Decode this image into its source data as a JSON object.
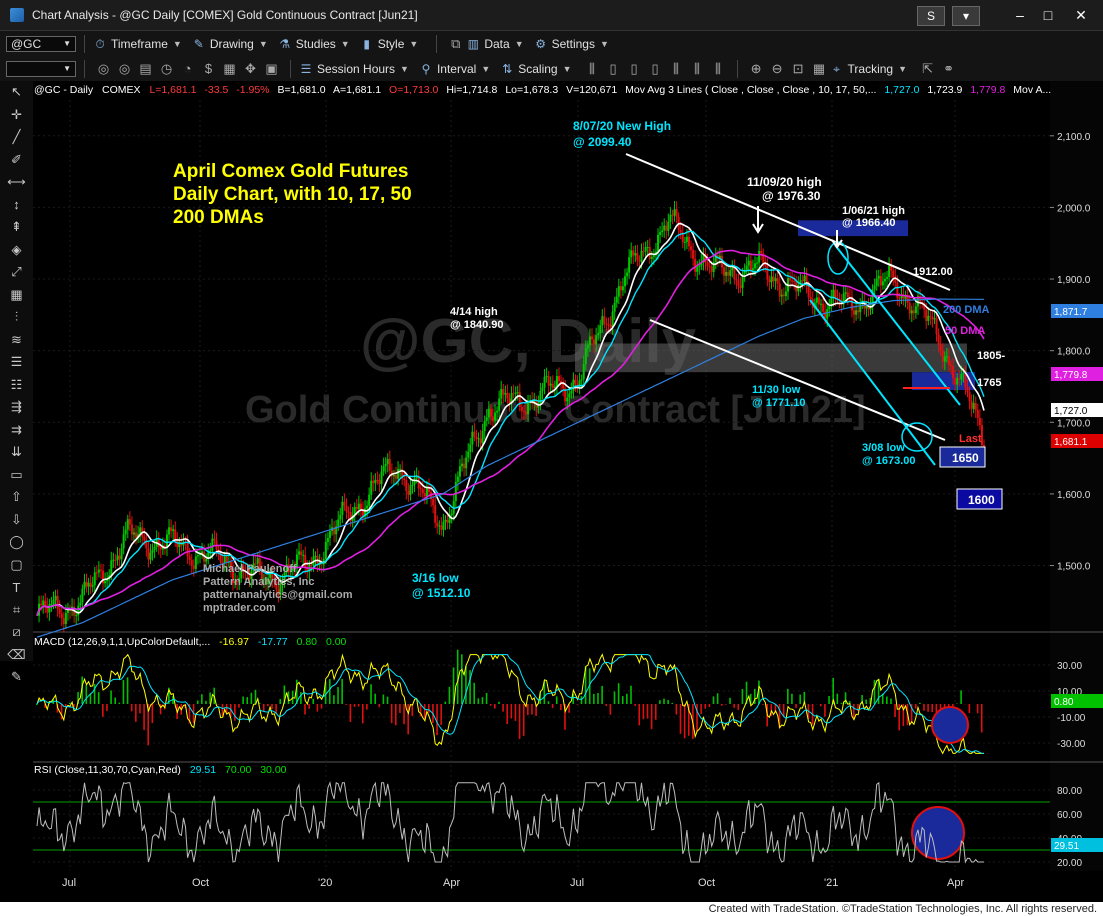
{
  "window": {
    "title": "Chart Analysis - @GC Daily [COMEX] Gold Continuous Contract [Jun21]",
    "s_button": "S",
    "minimize": "–",
    "maximize": "□",
    "close": "✕"
  },
  "toolbar1": {
    "symbol": "@GC",
    "timeframe": "Timeframe",
    "drawing": "Drawing",
    "studies": "Studies",
    "style": "Style",
    "data": "Data",
    "settings": "Settings"
  },
  "toolbar2": {
    "session_hours": "Session Hours",
    "interval": "Interval",
    "scaling": "Scaling",
    "tracking": "Tracking"
  },
  "status_line": {
    "symbol": "@GC - Daily",
    "exchange": "COMEX",
    "last": "L=1,681.1",
    "change": "-33.5",
    "change_pct": "-1.95%",
    "bid": "B=1,681.0",
    "ask": "A=1,681.1",
    "open": "O=1,713.0",
    "high": "Hi=1,714.8",
    "low": "Lo=1,678.3",
    "volume": "V=120,671",
    "study": "Mov Avg 3 Lines ( Close , Close , Close , 10, 17, 50,...",
    "ma1": "1,727.0",
    "ma2": "1,723.9",
    "ma3": "1,779.8",
    "tail": "Mov A..."
  },
  "colors": {
    "up_candle": "#00c800",
    "down_candle": "#e01010",
    "ma10": "#ffffff",
    "ma17": "#00e5ff",
    "ma50": "#e020e0",
    "ma200": "#2f7fe0",
    "annotation_yellow": "#ffff00",
    "annotation_cyan": "#00e5ff"
  },
  "chart_data": [
    {
      "type": "line",
      "title": "April Comex Gold Futures Daily Chart, with 10, 17, 50 200 DMAs",
      "watermark_symbol": "@GC, Daily",
      "watermark_name": "Gold Continuous Contract [Jun21]",
      "x_ticks": [
        "Jul",
        "Oct",
        "'20",
        "Apr",
        "Jul",
        "Oct",
        "'21",
        "Apr"
      ],
      "y_ticks": [
        "2,100.0",
        "2,000.0",
        "1,900.0",
        "1,800.0",
        "1,700.0",
        "1,600.0",
        "1,500.0"
      ],
      "ylim": [
        1410,
        2150
      ],
      "series": [
        {
          "name": "Price",
          "x": [
            "Jun'19",
            "Jul'19",
            "Aug'19",
            "Sep'19",
            "Oct'19",
            "Nov'19",
            "Dec'19",
            "Jan'20",
            "Feb'20",
            "Mar'20",
            "Apr'20",
            "May'20",
            "Jun'20",
            "Jul'20",
            "Aug'20",
            "Sep'20",
            "Oct'20",
            "Nov'20",
            "Dec'20",
            "Jan'21",
            "Feb'21",
            "Mar'21"
          ],
          "values": [
            1430,
            1450,
            1540,
            1530,
            1510,
            1480,
            1500,
            1580,
            1640,
            1560,
            1720,
            1735,
            1760,
            1900,
            1980,
            1910,
            1915,
            1880,
            1860,
            1900,
            1820,
            1680
          ]
        },
        {
          "name": "200 DMA",
          "values": [
            1400,
            1420,
            1450,
            1480,
            1500,
            1520,
            1540,
            1560,
            1580,
            1600,
            1640,
            1670,
            1700,
            1730,
            1760,
            1790,
            1820,
            1845,
            1860,
            1870,
            1872,
            1871.7
          ]
        }
      ],
      "last_values": {
        "price": "1,681.1",
        "ma10": "1,727.0",
        "ma50": "1,779.8",
        "ma200": "1,871.7"
      },
      "annotations": [
        {
          "label": "8/07/20 New High",
          "value_label": "@ 2099.40",
          "value": 2099.4
        },
        {
          "label": "11/09/20 high",
          "value_label": "@ 1976.30",
          "value": 1976.3
        },
        {
          "label": "1/06/21 high",
          "value_label": "@ 1966.40",
          "value": 1966.4
        },
        {
          "label": "4/14 high",
          "value_label": "@ 1840.90",
          "value": 1840.9
        },
        {
          "label": "11/30 low",
          "value_label": "@ 1771.10",
          "value": 1771.1
        },
        {
          "label": "3/08 low",
          "value_label": "@ 1673.00",
          "value": 1673.0
        },
        {
          "label": "3/16 low",
          "value_label": "@ 1512.10",
          "value": 1512.1
        }
      ],
      "level_labels": [
        "1912.00",
        "1805-",
        "1765",
        "1650",
        "1600",
        "Last"
      ],
      "ma_labels": [
        "200 DMA",
        "50 DMA"
      ],
      "credit": [
        "Michael Paulenoff",
        "Pattern Analytics, Inc",
        "patternanalytics@gmail.com",
        "mptrader.com"
      ]
    },
    {
      "type": "line",
      "title": "MACD (12,26,9,1,1,UpColorDefault,...",
      "readouts": [
        "-16.97",
        "-17.77",
        "0.80",
        "0.00"
      ],
      "y_ticks": [
        "30.00",
        "10.00",
        "-10.00",
        "-30.00"
      ],
      "last_value": "0.80",
      "ylim": [
        -40,
        40
      ]
    },
    {
      "type": "line",
      "title": "RSI (Close,11,30,70,Cyan,Red)",
      "readouts": [
        "29.51",
        "70.00",
        "30.00"
      ],
      "y_ticks": [
        "80.00",
        "60.00",
        "40.00",
        "20.00"
      ],
      "last_value": "29.51",
      "ylim": [
        15,
        90
      ]
    }
  ],
  "footer": "Created with TradeStation. ©TradeStation Technologies, Inc. All rights reserved."
}
